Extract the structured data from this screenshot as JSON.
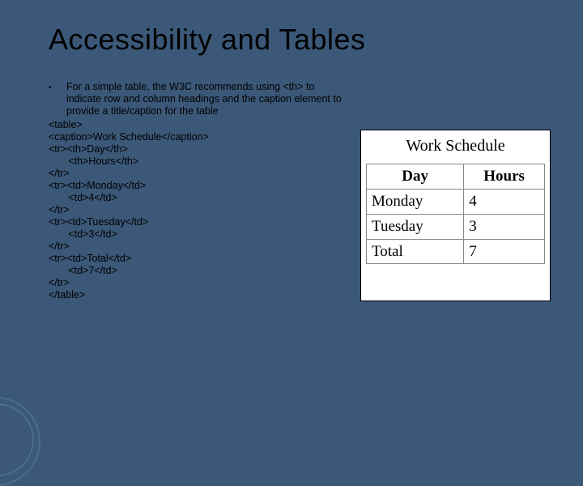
{
  "title": "Accessibility and Tables",
  "bullet": {
    "marker": "•",
    "text": "For a simple table, the W3C recommends using <th> to indicate row and column headings and the caption element to provide a title/caption for the table"
  },
  "code": {
    "l01": "<table>",
    "l02": "<caption>Work Schedule</caption>",
    "l03": "<tr><th>Day</th>",
    "l04": "       <th>Hours</th>",
    "l05": "</tr>",
    "l06": "<tr><td>Monday</td>",
    "l07": "       <td>4</td>",
    "l08": "</tr>",
    "l09": "<tr><td>Tuesday</td>",
    "l10": "       <td>3</td>",
    "l11": "</tr>",
    "l12": "<tr><td>Total</td>",
    "l13": "       <td>7</td>",
    "l14": "</tr>",
    "l15": "</table>"
  },
  "example": {
    "caption": "Work Schedule",
    "headers": {
      "day": "Day",
      "hours": "Hours"
    },
    "rows": [
      {
        "day": "Monday",
        "hours": "4"
      },
      {
        "day": "Tuesday",
        "hours": "3"
      },
      {
        "day": "Total",
        "hours": "7"
      }
    ]
  }
}
